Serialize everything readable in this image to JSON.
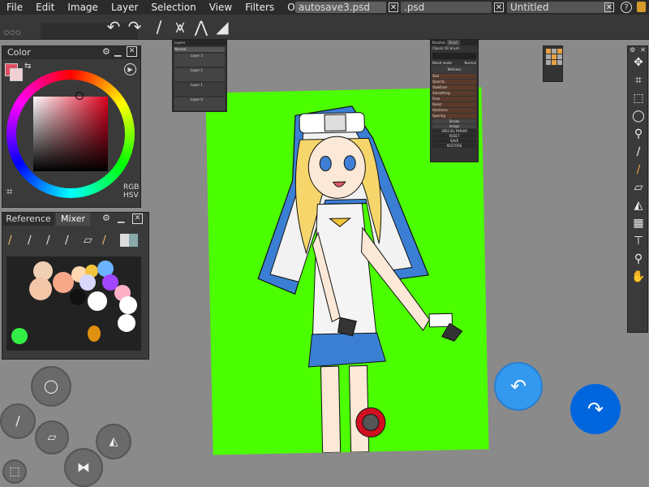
{
  "menu": [
    "File",
    "Edit",
    "Image",
    "Layer",
    "Selection",
    "View",
    "Filters",
    "Other"
  ],
  "tabs": [
    {
      "label": "autosave3.psd",
      "active": true
    },
    {
      "label": ".psd",
      "active": false
    },
    {
      "label": "Untitled",
      "active": false
    }
  ],
  "help_label": "?",
  "more_dots": "○○○",
  "color_panel": {
    "title": "Color",
    "modes": "RGB\nHSV"
  },
  "ref_panel": {
    "tabs": [
      "Reference",
      "Mixer"
    ]
  },
  "layers_panel": {
    "title": "Layers",
    "blend": "Normal",
    "layers": [
      "Layer 3",
      "Layer 2",
      "Layer 1",
      "Layer 0"
    ]
  },
  "brush_panel": {
    "tabs": [
      "Brushes",
      "Brush"
    ],
    "preset": "Classic Oil brush",
    "mode_label": "Blend mode",
    "mode_value": "Normal",
    "sections": [
      "Wetness",
      "Stroke",
      "Image"
    ],
    "params": [
      "Size",
      "Opacity",
      "Stabilizer",
      "Smoothing",
      "Flow",
      "Resat",
      "Hardness",
      "Spacing"
    ],
    "buttons": [
      "SPECIAL PARAM",
      "RESET",
      "SAVE",
      "RESTORE"
    ]
  },
  "colors": {
    "canvas": "#4cff00",
    "accent_blue": "#0066dd",
    "light_blue": "#3399ee"
  }
}
